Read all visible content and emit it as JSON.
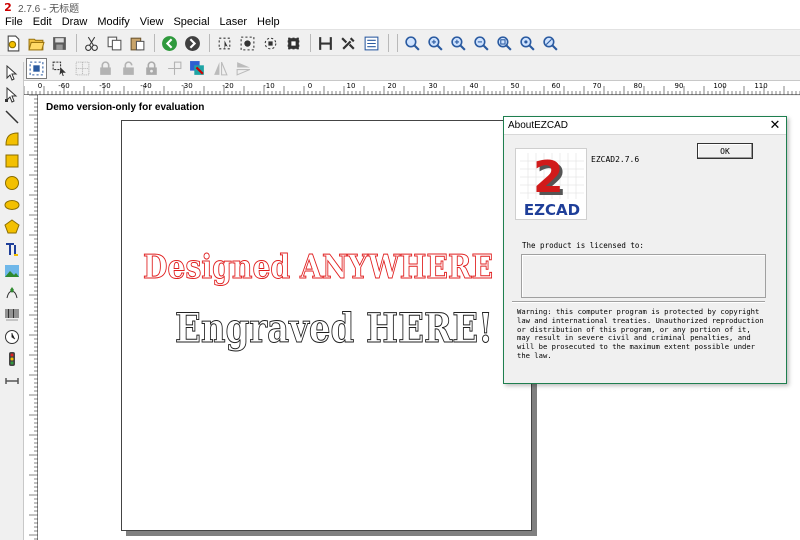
{
  "window": {
    "title": "2.7.6 - 无标题"
  },
  "menu": {
    "items": [
      "File",
      "Edit",
      "Draw",
      "Modify",
      "View",
      "Special",
      "Laser",
      "Help"
    ]
  },
  "toolbar": {
    "top_icons": [
      "new-file",
      "open-folder",
      "save",
      "cut",
      "copy",
      "paste",
      "undo",
      "redo",
      "select-region",
      "select-all",
      "node-edit",
      "reverse-select",
      "hatch",
      "tools",
      "properties",
      "zoom",
      "zoom-in",
      "zoom-in-2",
      "zoom-out",
      "zoom-fit",
      "zoom-select",
      "zoom-all"
    ],
    "second_icons": [
      "align",
      "group-edit",
      "grid",
      "lock",
      "unlock",
      "lock-2",
      "cursor-move",
      "color-object",
      "mirror-horizontal",
      "mirror-vertical"
    ]
  },
  "left_tools": [
    "select-arrow",
    "node-edit",
    "line",
    "curve",
    "rectangle",
    "circle",
    "ellipse",
    "polygon",
    "text",
    "bitmap",
    "vector-file",
    "barcode",
    "timer",
    "io-input",
    "output"
  ],
  "ruler": {
    "horizontal_labels": [
      "0",
      "-60",
      "-50",
      "-40",
      "-30",
      "-20",
      "-10",
      "0",
      "10",
      "20",
      "30",
      "40",
      "50",
      "60",
      "70",
      "80",
      "90",
      "100",
      "110"
    ]
  },
  "canvas": {
    "demo_notice": "Demo version-only for evaluation",
    "line1": "Designed ANYWHERE",
    "line2": "Engraved HERE!",
    "line1_color": "#e02020",
    "line2_color": "#222222"
  },
  "about_dialog": {
    "title": "AboutEZCAD",
    "close": "✕",
    "logo_digit": "2",
    "logo_text": "EZCAD",
    "version": "EZCAD2.7.6",
    "ok_label": "OK",
    "license_label": "The product is licensed to:",
    "license_value": "",
    "warning": "Warning: this computer program is protected by copyright\nlaw and international treaties. Unauthorized reproduction\nor distribution of this program, or any portion of it,\nmay result in severe civil and criminal penalties, and\nwill be prosecuted to the maximum extent possible under\nthe law.",
    "accent_color": "#1e7f4f"
  }
}
